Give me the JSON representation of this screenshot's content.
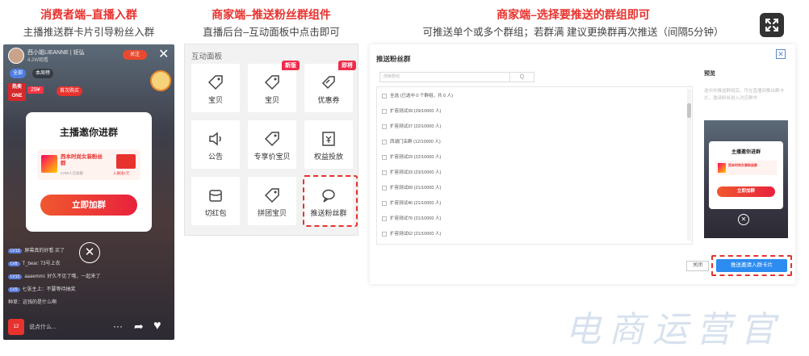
{
  "sections": [
    {
      "title": "消费者端–直播入群",
      "subtitle": "主播推送群卡片引导粉丝入群"
    },
    {
      "title": "商家端–推送粉丝群组件",
      "subtitle": "直播后台–互动面板中点击即可"
    },
    {
      "title": "商家端–选择要推送的群组即可",
      "subtitle": "可推送单个或多个群组；若群满 建议更换群再次推送（间隔5分钟）"
    }
  ],
  "phone": {
    "streamer_name": "西小姐LIEANNE | 钜弘",
    "streamer_sub": "4.2W观看",
    "follow": "关注",
    "chip1": "全部",
    "chip2": "本周榜",
    "hot": "热卖 ONE",
    "price": "29¥",
    "price_tag": "首次购买",
    "invite_title": "主播邀你进群",
    "group_name": "西本时尚女装粉丝群",
    "group_meta": "4790人已加群",
    "gift_label": "入群送1元",
    "join_button": "立即加群",
    "chat": [
      {
        "lvl": "LV13",
        "text": "屏幕真的好看 买了"
      },
      {
        "lvl": "LV8",
        "text": "T_bear: 73号上衣"
      },
      {
        "lvl": "LV12",
        "text": "aaaemmi: 好久不见了哦，一起来了"
      },
      {
        "lvl": "LV9",
        "text": "七张主上：不要等待抽奖"
      },
      {
        "lvl": "",
        "text": "种草：这钱的是什么啊"
      }
    ],
    "bag_count": "12",
    "say_placeholder": "说点什么..."
  },
  "interact": {
    "title": "互动面板",
    "tiles": [
      {
        "label": "宝贝",
        "badge": ""
      },
      {
        "label": "宝贝",
        "badge": "新版"
      },
      {
        "label": "优惠券",
        "badge": "即将"
      },
      {
        "label": "公告",
        "badge": ""
      },
      {
        "label": "专享价宝贝",
        "badge": ""
      },
      {
        "label": "权益投放",
        "badge": ""
      },
      {
        "label": "切红包",
        "badge": ""
      },
      {
        "label": "拼团宝贝",
        "badge": ""
      },
      {
        "label": "推送粉丝群",
        "badge": ""
      }
    ]
  },
  "dialog": {
    "title": "推送粉丝群",
    "search_placeholder": "搜索群组",
    "search_button": "Q",
    "rows": [
      "全选 (已选中 0 个群组，共 0 人)",
      "扩容测试39 (29/10000 人)",
      "扩容测试37 (22/10000 人)",
      "西湖门店群 (12/10000 人)",
      "扩容测试29 (22/10000 人)",
      "扩容测试33 (23/10000 人)",
      "扩容测试89 (21/10000 人)",
      "扩容测试46 (21/10000 人)",
      "扩容测试76 (21/10000 人)",
      "扩容测试62 (21/10000 人)"
    ],
    "preview_title": "预览",
    "preview_desc": "选中并推送群组后，可在直播间推出群卡片，邀请粉丝进入对应群中",
    "preview_card_title": "主播邀你进群",
    "preview_group_name": "西本时尚女装粉丝群",
    "preview_join": "立即加群",
    "close_button": "关闭",
    "push_button": "推送邀请入群卡片"
  },
  "watermark": "电商运营官"
}
